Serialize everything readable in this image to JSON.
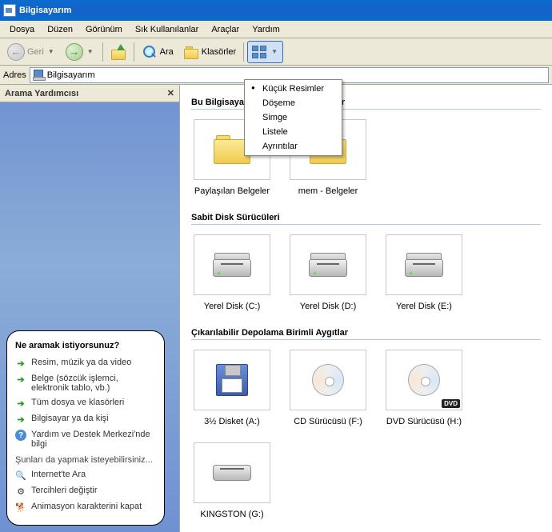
{
  "title": "Bilgisayarım",
  "menubar": [
    "Dosya",
    "Düzen",
    "Görünüm",
    "Sık Kullanılanlar",
    "Araçlar",
    "Yardım"
  ],
  "toolbar": {
    "back": "Geri",
    "search": "Ara",
    "folders": "Klasörler"
  },
  "address": {
    "label": "Adres",
    "value": "Bilgisayarım"
  },
  "sidepanel": {
    "title": "Arama Yardımcısı",
    "balloon": {
      "heading": "Ne aramak istiyorsunuz?",
      "options": [
        "Resim, müzik ya da video",
        "Belge (sözcük işlemci, elektronik tablo, vb.)",
        "Tüm dosya ve klasörleri",
        "Bilgisayar ya da kişi",
        "Yardım ve Destek Merkezi'nde bilgi"
      ],
      "sub": "Şunları da yapmak isteyebilirsiniz...",
      "sub_options": [
        "Internet'te Ara",
        "Tercihleri değiştir",
        "Animasyon karakterini kapat"
      ]
    }
  },
  "views_menu": [
    "Küçük Resimler",
    "Döşeme",
    "Simge",
    "Listele",
    "Ayrıntılar"
  ],
  "views_selected": 0,
  "sections": [
    {
      "title": "Bu Bilgisayarda Depolanan Dosyalar",
      "title_visible": "Bu Bilgisayard",
      "title_rest": "r",
      "items": [
        {
          "label": "Paylaşılan Belgeler",
          "type": "folder"
        },
        {
          "label": "mem - Belgeler",
          "type": "folder"
        }
      ]
    },
    {
      "title": "Sabit Disk Sürücüleri",
      "items": [
        {
          "label": "Yerel Disk (C:)",
          "type": "disk"
        },
        {
          "label": "Yerel Disk (D:)",
          "type": "disk"
        },
        {
          "label": "Yerel Disk (E:)",
          "type": "disk"
        }
      ]
    },
    {
      "title": "Çıkarılabilir Depolama Birimli Aygıtlar",
      "items": [
        {
          "label": "3½ Disket (A:)",
          "type": "floppy"
        },
        {
          "label": "CD Sürücüsü (F:)",
          "type": "cd"
        },
        {
          "label": "DVD Sürücüsü (H:)",
          "type": "dvd"
        },
        {
          "label": "KINGSTON (G:)",
          "type": "ext"
        }
      ]
    }
  ]
}
